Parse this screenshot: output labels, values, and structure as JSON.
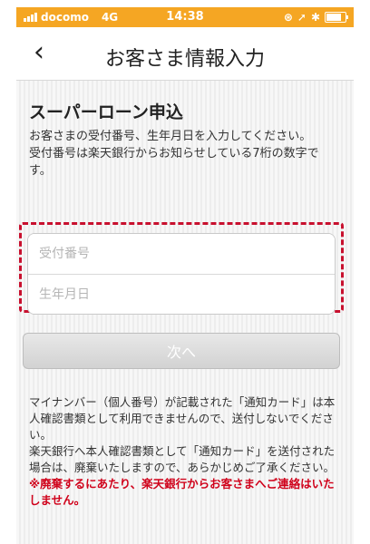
{
  "status_bar": {
    "carrier": "docomo",
    "network": "4G",
    "time": "14:38"
  },
  "nav": {
    "back_glyph": "‹",
    "title": "お客さま情報入力"
  },
  "page": {
    "heading": "スーパーローン申込",
    "intro_1": "お客さまの受付番号、生年月日を入力してください。",
    "intro_2": "受付番号は楽天銀行からお知らせしている7桁の数字です。"
  },
  "form": {
    "reception_number_placeholder": "受付番号",
    "birthdate_placeholder": "生年月日",
    "next_label": "次へ"
  },
  "notice": {
    "text_1": "マイナンバー（個人番号）が記載された「通知カード」は本人確認書類として利用できませんので、送付しないでください。",
    "text_2": "楽天銀行へ本人確認書類として「通知カード」を送付された場合は、廃棄いたしますので、あらかじめご了承ください。",
    "warning": "※廃棄するにあたり、楽天銀行からお客さまへご連絡はいたしません。"
  },
  "colors": {
    "status_bar": "#f5a623",
    "highlight": "#c8102e",
    "warning": "#d0021b"
  }
}
